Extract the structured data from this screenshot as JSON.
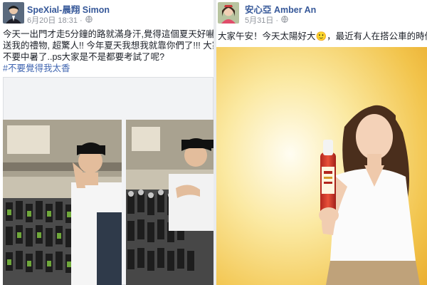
{
  "posts": [
    {
      "author": "SpeXial-晨翔 Simon",
      "date": "6月20日 18:31 ·",
      "text_lines": [
        "今天一出門才走5分鐘的路就滿身汗,覺得這個夏天好嚇人！謝",
        "送我的禮物, 超驚人!! 今年夏天我想我就靠你們了!!! 大家出門都",
        "不要中暑了..ps大家是不是都要考試了呢?"
      ],
      "hashtag": "#不要覺得我太香"
    },
    {
      "author": "安心亞 Amber An",
      "date": "5月31日 ·",
      "text_lines": [
        "大家午安！今天太陽好大🙂，最近有人在搭公車的時候遇到"
      ]
    }
  ],
  "icons": {
    "globe": "globe-icon"
  },
  "colors": {
    "author_link": "#365899",
    "hashtag": "#4267b2",
    "meta_text": "#90949c",
    "body_text": "#1d2129",
    "page_bg": "#e9ebee"
  }
}
